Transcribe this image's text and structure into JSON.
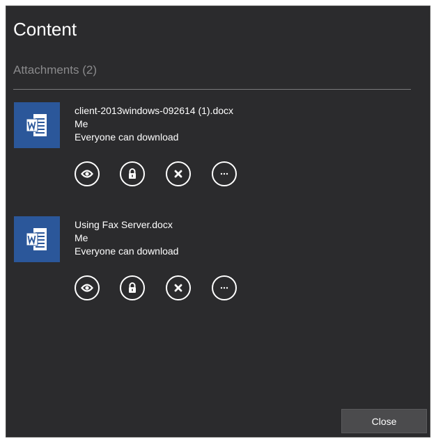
{
  "dialog": {
    "title": "Content",
    "section_label": "Attachments (2)",
    "close_label": "Close"
  },
  "attachments": [
    {
      "filename": "client-2013windows-092614 (1).docx",
      "owner": "Me",
      "permission": "Everyone can download",
      "icon": "word-document-icon"
    },
    {
      "filename": "Using Fax Server.docx",
      "owner": "Me",
      "permission": "Everyone can download",
      "icon": "word-document-icon"
    }
  ],
  "actions": [
    "view-icon",
    "lock-icon",
    "remove-icon",
    "more-icon"
  ],
  "colors": {
    "panel_bg": "#2b2b2d",
    "word_blue": "#2b579a",
    "button_bg": "#4b4b4d",
    "muted_text": "#8a8a8c"
  }
}
